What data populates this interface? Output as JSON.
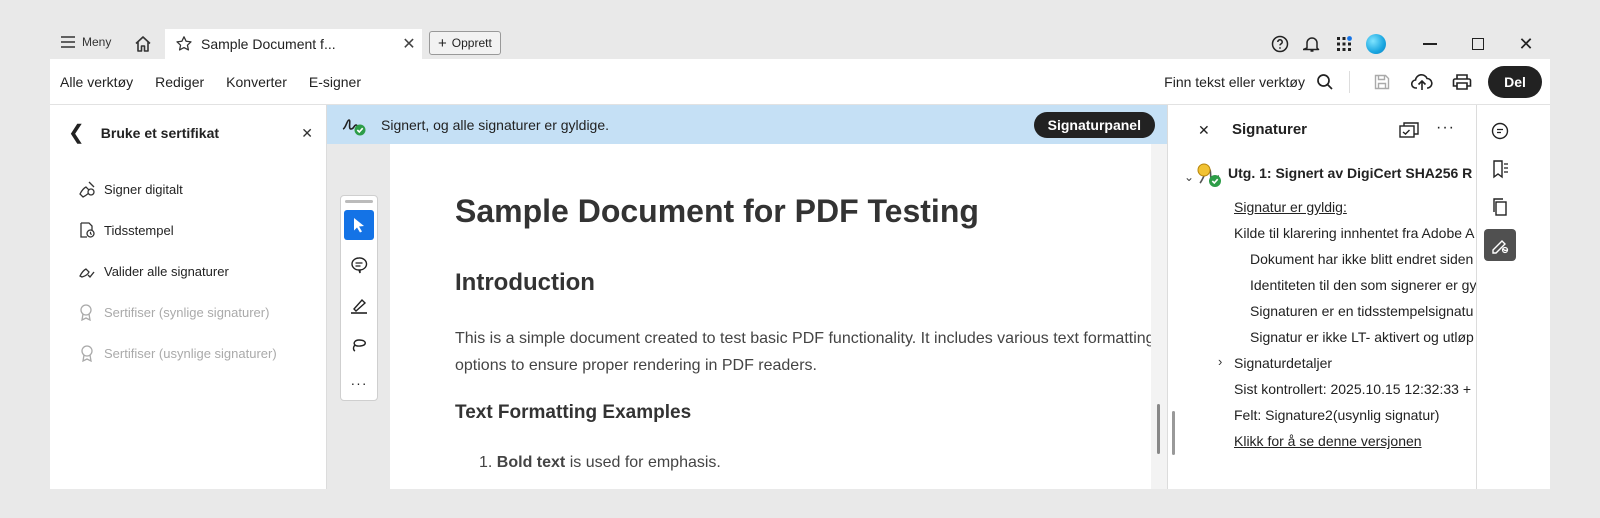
{
  "titlebar": {
    "menu_label": "Meny",
    "tab_title": "Sample Document f...",
    "new_button_label": "Opprett",
    "icons": [
      "help-icon",
      "bell-icon",
      "apps-grid-icon",
      "profile-avatar"
    ]
  },
  "toolbar": {
    "tabs": [
      "Alle verktøy",
      "Rediger",
      "Konverter",
      "E-signer"
    ],
    "find_label": "Finn tekst eller verktøy",
    "share_label": "Del"
  },
  "left_panel": {
    "title": "Bruke et sertifikat",
    "items": [
      {
        "label": "Signer digitalt",
        "enabled": true
      },
      {
        "label": "Tidsstempel",
        "enabled": true
      },
      {
        "label": "Valider alle signaturer",
        "enabled": true
      },
      {
        "label": "Sertifiser (synlige signaturer)",
        "enabled": false
      },
      {
        "label": "Sertifiser (usynlige signaturer)",
        "enabled": false
      }
    ]
  },
  "banner": {
    "message": "Signert, og alle signaturer er gyldige.",
    "button_label": "Signaturpanel"
  },
  "document": {
    "h1": "Sample Document for PDF Testing",
    "h2": "Introduction",
    "paragraph": "This is a simple document created to test basic PDF functionality. It includes various text formatting options to ensure proper rendering in PDF readers.",
    "h3": "Text Formatting Examples",
    "list_number": "1.",
    "list_bold": "Bold text",
    "list_rest": " is used for emphasis."
  },
  "right_panel": {
    "title": "Signaturer",
    "rev_label": "Utg. 1: Signert av DigiCert SHA256 R",
    "valid_label": "Signatur er gyldig:",
    "trust_source": "Kilde til klarering innhentet fra Adobe A",
    "details": [
      "Dokument har ikke blitt endret siden",
      "Identiteten til den som signerer er gy",
      "Signaturen er en tidsstempelsignatu",
      "Signatur er ikke LT- aktivert og utløp"
    ],
    "details_toggle": "Signaturdetaljer",
    "last_checked": "Sist kontrollert: 2025.10.15 12:32:33 +",
    "field": "Felt: Signature2(usynlig signatur)",
    "view_version": "Klikk for å se denne versjonen"
  },
  "colors": {
    "banner_bg": "#c5e0f5",
    "accent_blue": "#1473e6",
    "dark_button": "#222222"
  }
}
